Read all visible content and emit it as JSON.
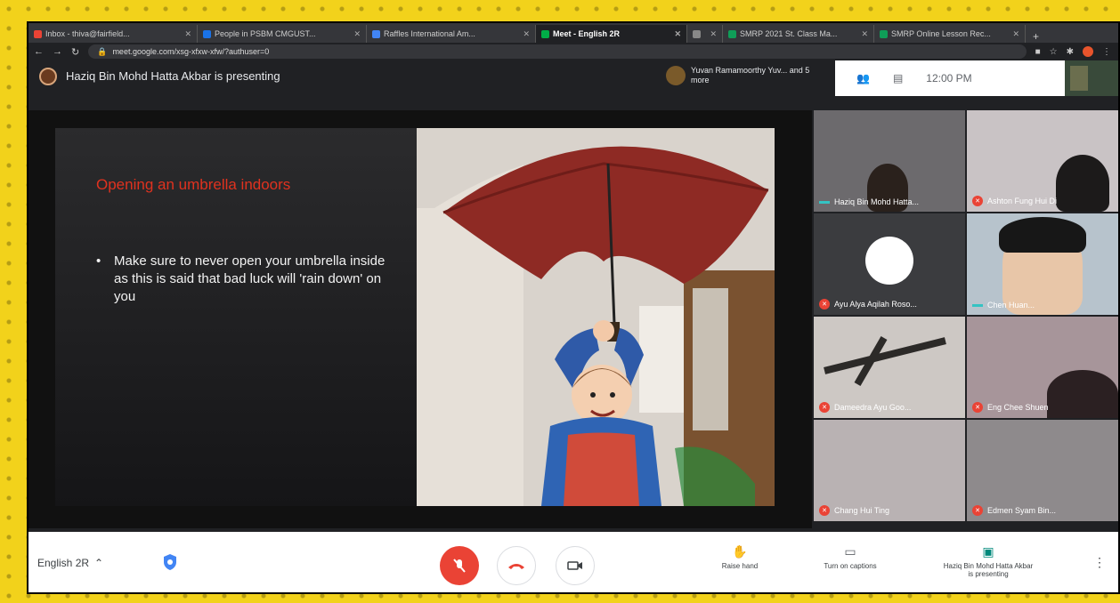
{
  "browser": {
    "tabs": [
      {
        "label": "Inbox - thiva@fairfield...",
        "color": "#ea4335"
      },
      {
        "label": "People in PSBM CMGUST...",
        "color": "#1a73e8"
      },
      {
        "label": "Raffles International Am...",
        "color": "#4285f4"
      },
      {
        "label": "Meet - English 2R",
        "color": "#00ac47",
        "active": true
      },
      {
        "label": "",
        "color": "#888"
      },
      {
        "label": "SMRP 2021 St. Class Ma...",
        "color": "#0f9d58"
      },
      {
        "label": "SMRP Online Lesson Rec...",
        "color": "#0f9d58"
      }
    ],
    "url": "meet.google.com/xsg-xfxw-xfw/?authuser=0"
  },
  "meet": {
    "presenting_text": "Haziq Bin Mohd Hatta Akbar is presenting",
    "also_presenting": "Yuvan Ramamoorthy Yuv... and 5 more",
    "time": "12:00 PM",
    "meeting_name": "English 2R",
    "slide": {
      "title": "Opening an umbrella indoors",
      "bullet": "Make sure to never open your umbrella inside as this is said that bad luck will 'rain down' on you"
    },
    "participants": [
      {
        "name": "Haziq Bin Mohd Hatta..."
      },
      {
        "name": "Ashton Fung Hui Di"
      },
      {
        "name": "Ayu Alya Aqilah Roso..."
      },
      {
        "name": "Chen Huan..."
      },
      {
        "name": "Dameedra Ayu Goo..."
      },
      {
        "name": "Eng Chee Shuen"
      },
      {
        "name": "Chang Hui Ting"
      },
      {
        "name": "Edmen Syam Bin..."
      }
    ],
    "controls": {
      "raise_hand": "Raise hand",
      "captions": "Turn on captions",
      "presenting_line1": "Haziq Bin Mohd Hatta Akbar",
      "presenting_line2": "is presenting"
    }
  }
}
